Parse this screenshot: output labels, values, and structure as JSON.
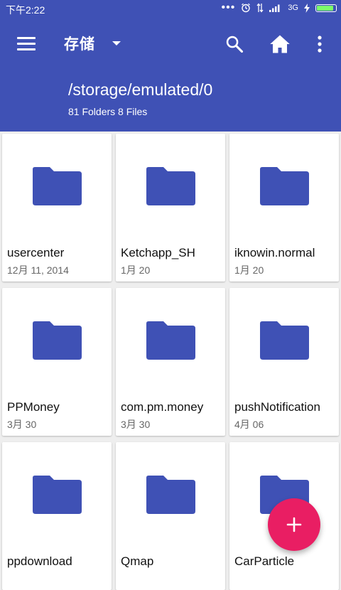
{
  "status_bar": {
    "time": "下午2:22",
    "network": "3G",
    "battery_level": 0.95
  },
  "toolbar": {
    "title": "存储",
    "path": "/storage/emulated/0",
    "summary": "81 Folders 8 Files",
    "icons": [
      "menu-icon",
      "chevron-down-icon",
      "search-icon",
      "home-icon",
      "more-vert-icon"
    ]
  },
  "colors": {
    "primary": "#3f51b5",
    "folder": "#3f51b5",
    "fab": "#e91e63"
  },
  "items": [
    {
      "name": "usercenter",
      "date": "12月 11, 2014"
    },
    {
      "name": "Ketchapp_SH",
      "date": "1月 20"
    },
    {
      "name": "iknowin.normal",
      "date": "1月 20"
    },
    {
      "name": "PPMoney",
      "date": "3月 30"
    },
    {
      "name": "com.pm.money",
      "date": "3月 30"
    },
    {
      "name": "pushNotification",
      "date": "4月 06"
    },
    {
      "name": "ppdownload",
      "date": ""
    },
    {
      "name": "Qmap",
      "date": ""
    },
    {
      "name": "CarParticle",
      "date": ""
    }
  ],
  "fab": {
    "icon": "plus-icon"
  }
}
